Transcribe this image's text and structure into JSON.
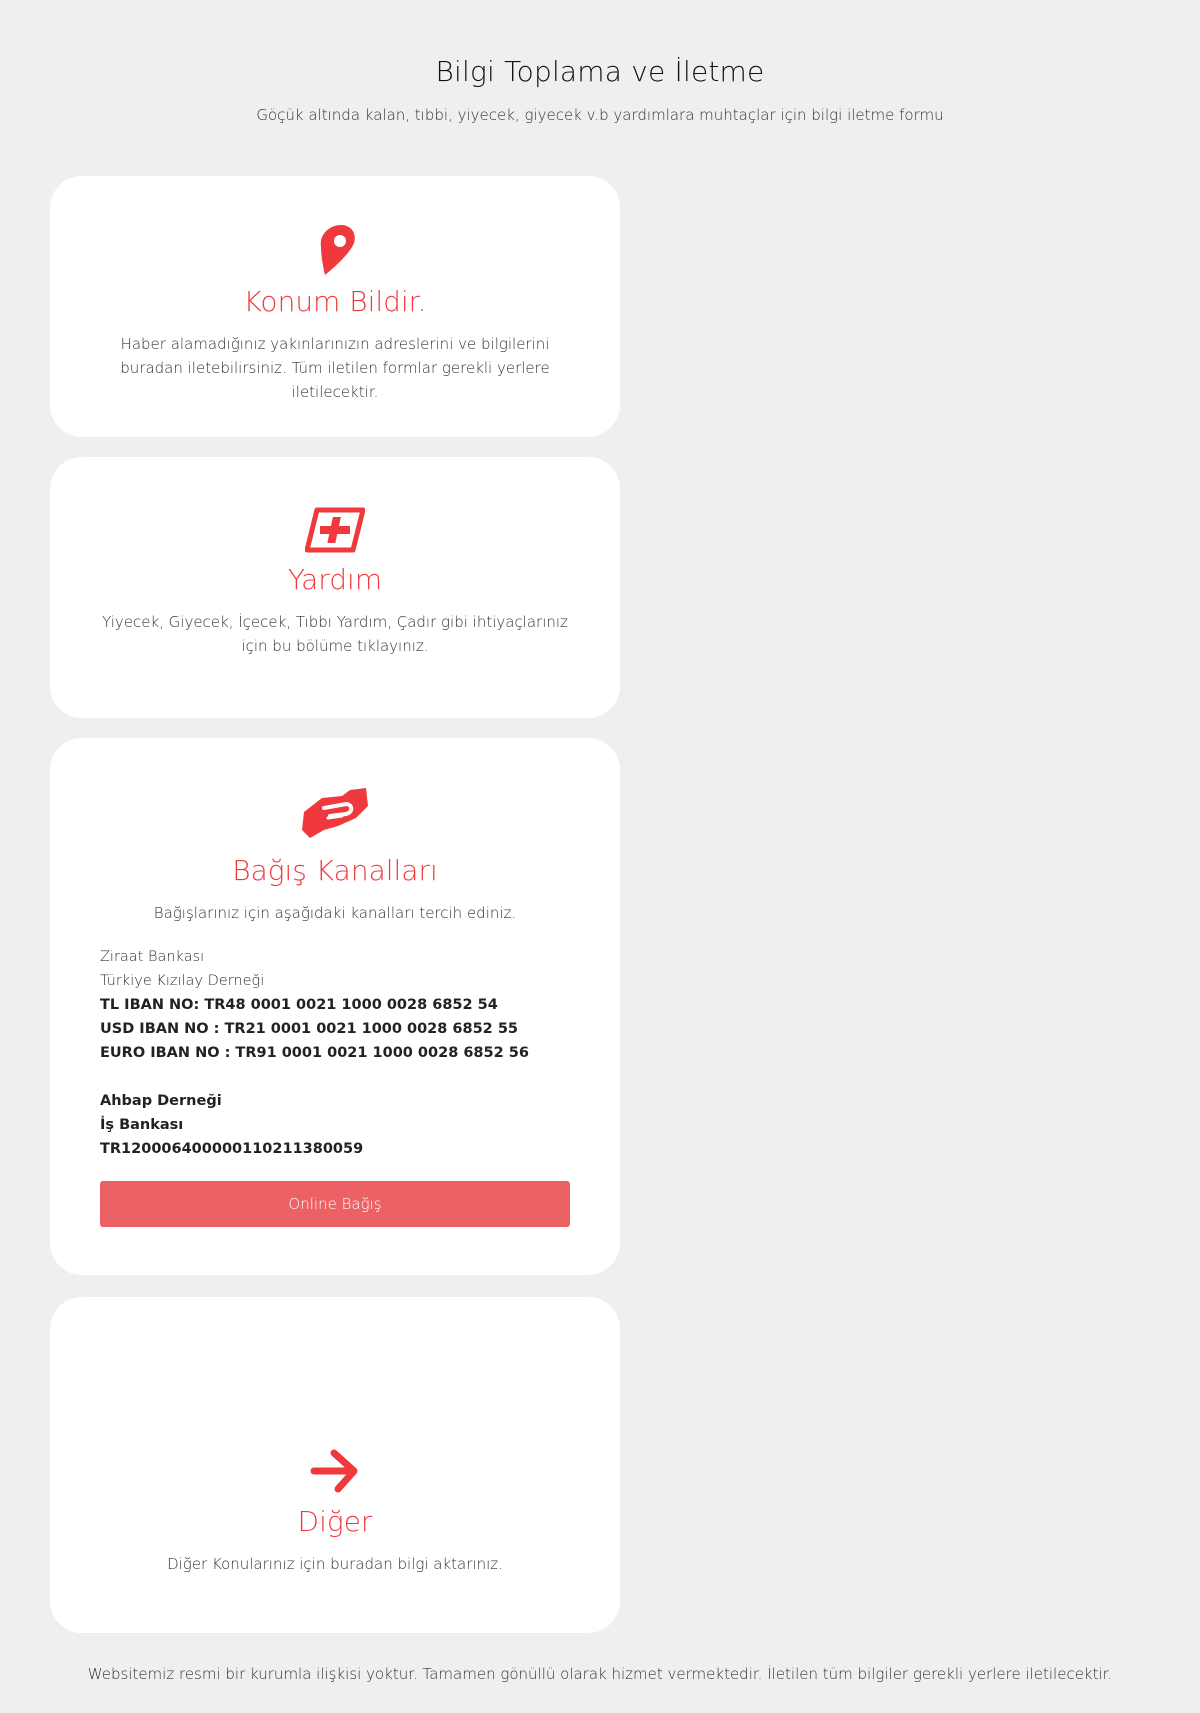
{
  "header": {
    "title": "Bilgi Toplama ve İletme",
    "subtitle": "Göçük altında kalan, tıbbi, yiyecek, giyecek v.b yardımlara muhtaçlar için bilgi iletme formu"
  },
  "cards": {
    "location": {
      "icon": "location-pin-icon",
      "title": "Konum Bildir.",
      "description": "Haber alamadığınız yakınlarınızın adreslerini ve bilgilerini buradan iletebilirsiniz. Tüm iletilen formlar gerekli yerlere iletilecektir."
    },
    "help": {
      "icon": "medical-cross-icon",
      "title": "Yardım",
      "description": "Yiyecek, Giyecek, İçecek, Tıbbı Yardım, Çadır gibi ihtiyaçlarınız için bu bölüme tıklayınız."
    },
    "donation": {
      "icon": "handshake-icon",
      "title": "Bağış Kanalları",
      "description": "Bağışlarınız için aşağıdaki kanalları tercih ediniz.",
      "bank1": {
        "bank_name": "Ziraat Bankası",
        "account_holder": "Türkiye Kızılay Derneği",
        "tl_iban": "TL IBAN NO: TR48 0001 0021 1000 0028 6852 54",
        "usd_iban": "USD IBAN NO : TR21 0001 0021 1000 0028 6852 55",
        "euro_iban": "EURO IBAN NO : TR91 0001 0021 1000 0028 6852 56"
      },
      "bank2": {
        "org_name": "Ahbap Derneği",
        "bank_name": "İş Bankası",
        "iban": "TR120006400000110211380059"
      },
      "button_label": "Online Bağış"
    },
    "other": {
      "icon": "arrow-right-icon",
      "title": "Diğer",
      "description": "Diğer Konularınız için buradan bilgi aktarınız."
    }
  },
  "footer": {
    "text": "Websitemiz resmi bir kurumla ilişkisi yoktur. Tamamen gönüllü olarak hizmet vermektedir. İletilen tüm bilgiler gerekli yerlere iletilecektir."
  },
  "colors": {
    "accent": "#f0393d",
    "button": "#ec6164",
    "background": "#efefef",
    "card": "#ffffff"
  }
}
